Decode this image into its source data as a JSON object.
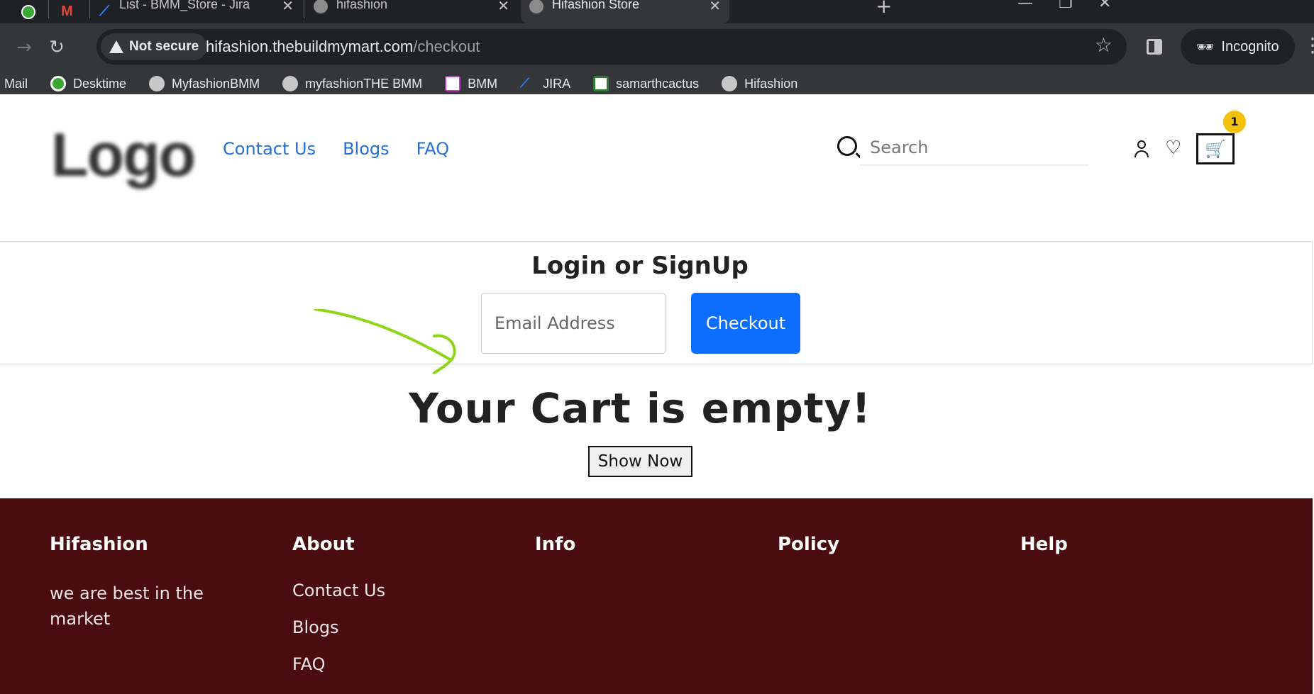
{
  "browser": {
    "tabs": [
      {
        "label": "",
        "icon": "green-app-icon"
      },
      {
        "label": "",
        "icon": "gmail-icon"
      },
      {
        "label": "List - BMM_Store - Jira",
        "icon": "jira-icon"
      },
      {
        "label": "hifashion",
        "icon": "globe-icon"
      },
      {
        "label": "Hifashion Store",
        "icon": "globe-icon",
        "active": true
      }
    ],
    "omnibox": {
      "security_label": "Not secure",
      "url_host": "hifashion.thebuildmymart.com",
      "url_path": "/checkout"
    },
    "profile_label": "Incognito",
    "bookmarks": [
      {
        "label": "Mail",
        "icon": "none"
      },
      {
        "label": "Desktime",
        "icon": "desktime-icon"
      },
      {
        "label": "MyfashionBMM",
        "icon": "globe-icon"
      },
      {
        "label": "myfashionTHE BMM",
        "icon": "globe-icon"
      },
      {
        "label": "BMM",
        "icon": "bmm-icon"
      },
      {
        "label": "JIRA",
        "icon": "jira-icon"
      },
      {
        "label": "samarthcactus",
        "icon": "cactus-icon"
      },
      {
        "label": "Hifashion",
        "icon": "globe-icon"
      }
    ]
  },
  "header": {
    "logo_text": "Logo",
    "nav": [
      "Contact Us",
      "Blogs",
      "FAQ"
    ],
    "search_placeholder": "Search",
    "cart_count": "1"
  },
  "login": {
    "title": "Login or SignUp",
    "email_placeholder": "Email Address",
    "checkout_label": "Checkout"
  },
  "cart": {
    "empty_message": "Your Cart is empty!",
    "shop_button": "Show Now"
  },
  "footer": {
    "columns": [
      {
        "heading": "Hifashion",
        "text": "we are best in the market"
      },
      {
        "heading": "About",
        "links": [
          "Contact Us",
          "Blogs",
          "FAQ"
        ]
      },
      {
        "heading": "Info"
      },
      {
        "heading": "Policy"
      },
      {
        "heading": "Help"
      }
    ]
  },
  "colors": {
    "accent": "#0d6efd",
    "nav_link": "#2470d6",
    "footer_bg": "#4a0c0f",
    "badge": "#f4c20d",
    "annotation": "#8fd61a"
  }
}
